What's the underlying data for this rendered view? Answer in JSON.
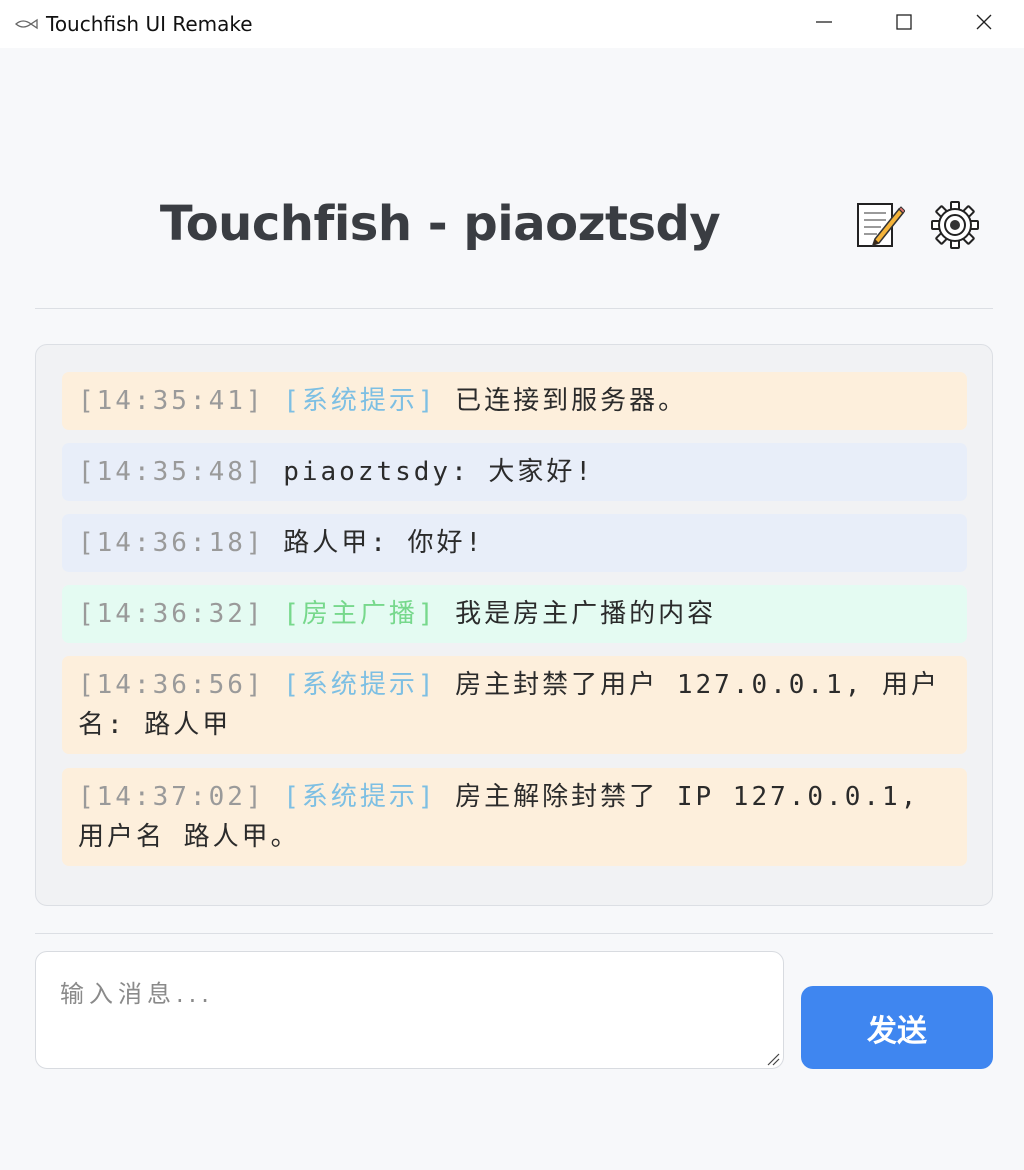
{
  "window": {
    "title": "Touchfish UI Remake",
    "app_icon": "fish-icon",
    "controls": [
      "minimize-icon",
      "maximize-icon",
      "close-icon"
    ]
  },
  "header": {
    "title": "Touchfish - piaoztsdy",
    "icons": [
      "memo-icon",
      "gear-icon"
    ]
  },
  "messages": [
    {
      "type": "system",
      "time": "[14:35:41]",
      "tag": "[系统提示]",
      "text": "已连接到服务器。"
    },
    {
      "type": "user",
      "time": "[14:35:48]",
      "sender": "piaoztsdy:",
      "text": "大家好!"
    },
    {
      "type": "user",
      "time": "[14:36:18]",
      "sender": "路人甲:",
      "text": "你好!"
    },
    {
      "type": "broadcast",
      "time": "[14:36:32]",
      "tag": "[房主广播]",
      "text": "我是房主广播的内容"
    },
    {
      "type": "system",
      "time": "[14:36:56]",
      "tag": "[系统提示]",
      "text": "房主封禁了用户 127.0.0.1, 用户名: 路人甲"
    },
    {
      "type": "system",
      "time": "[14:37:02]",
      "tag": "[系统提示]",
      "text": "房主解除封禁了 IP 127.0.0.1, 用户名 路人甲。"
    }
  ],
  "composer": {
    "placeholder": "输入消息...",
    "value": "",
    "send_label": "发送"
  },
  "colors": {
    "accent": "#3f86f0",
    "system_bg": "#fdefdc",
    "user_bg": "#e8eef9",
    "broadcast_bg": "#e4fbf2",
    "system_tag": "#7dbfe3",
    "broadcast_tag": "#77d88c",
    "timestamp": "#9a9a9a"
  }
}
